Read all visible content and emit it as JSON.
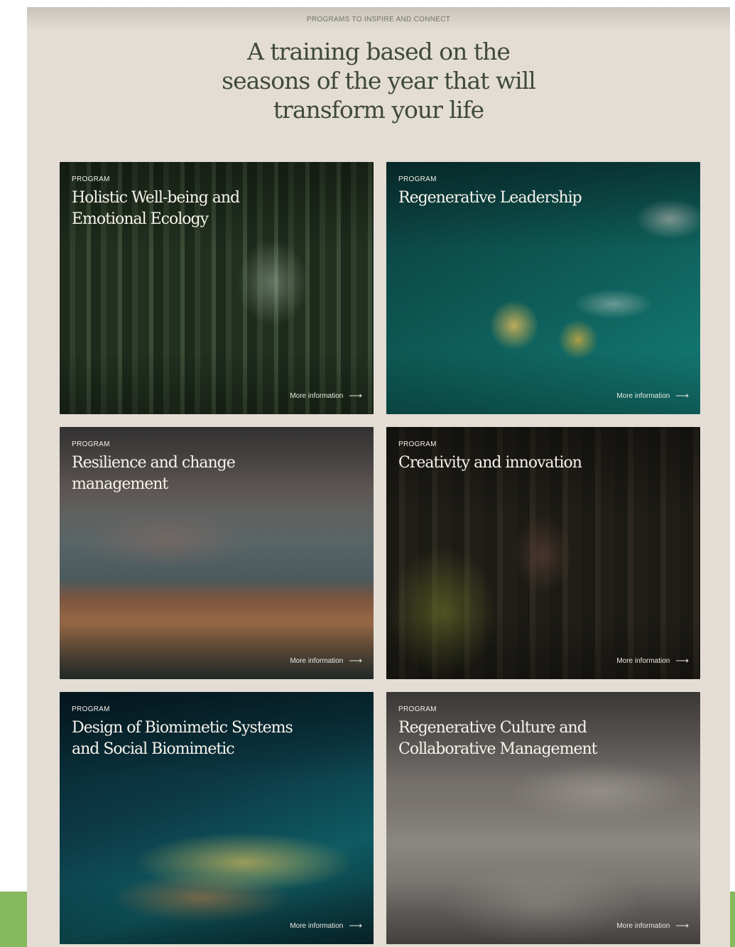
{
  "header": {
    "eyebrow": "PROGRAMS TO INSPIRE AND CONNECT",
    "headline": "A training based on the seasons of the year that will transform your life"
  },
  "cards": [
    {
      "label": "PROGRAM",
      "title": "Holistic Well-being and Emotional Ecology",
      "cta": "More information"
    },
    {
      "label": "PROGRAM",
      "title": "Regenerative Leadership",
      "cta": "More information"
    },
    {
      "label": "PROGRAM",
      "title": "Resilience and change management",
      "cta": "More information"
    },
    {
      "label": "PROGRAM",
      "title": "Creativity and innovation",
      "cta": "More information"
    },
    {
      "label": "PROGRAM",
      "title": "Design of Biomimetic Systems and Social Biomimetic",
      "cta": "More information"
    },
    {
      "label": "PROGRAM",
      "title": "Regenerative Culture and Collaborative Management",
      "cta": "More information"
    }
  ],
  "icons": {
    "cta_arrow": "arrow-right-icon"
  },
  "colors": {
    "background": "#e4ddd5",
    "heading": "#3f4a3a",
    "accent_green": "#86b95b"
  }
}
